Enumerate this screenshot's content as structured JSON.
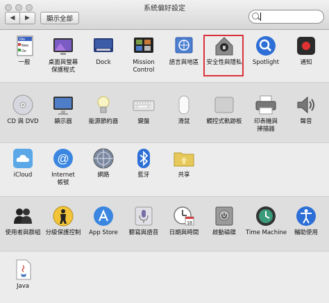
{
  "window": {
    "title": "系統偏好設定"
  },
  "toolbar": {
    "back": "◀",
    "forward": "▶",
    "show_all": "顯示全部"
  },
  "search": {
    "value": ""
  },
  "rows": [
    {
      "items": [
        {
          "label": "一般",
          "icon": "general-icon"
        },
        {
          "label": "桌面與螢幕\n保護程式",
          "icon": "desktop-icon"
        },
        {
          "label": "Dock",
          "icon": "dock-icon"
        },
        {
          "label": "Mission\nControl",
          "icon": "mission-control-icon"
        },
        {
          "label": "語言與地區",
          "icon": "language-icon"
        },
        {
          "label": "安全性與隱私",
          "icon": "security-icon"
        },
        {
          "label": "Spotlight",
          "icon": "spotlight-icon"
        },
        {
          "label": "通知",
          "icon": "notifications-icon"
        }
      ]
    },
    {
      "items": [
        {
          "label": "CD 與 DVD",
          "icon": "cd-dvd-icon"
        },
        {
          "label": "顯示器",
          "icon": "display-icon"
        },
        {
          "label": "能源節約器",
          "icon": "energy-icon"
        },
        {
          "label": "鍵盤",
          "icon": "keyboard-icon"
        },
        {
          "label": "滑鼠",
          "icon": "mouse-icon"
        },
        {
          "label": "觸控式軌跡板",
          "icon": "trackpad-icon"
        },
        {
          "label": "印表機與\n掃描器",
          "icon": "printer-icon"
        },
        {
          "label": "聲音",
          "icon": "sound-icon"
        }
      ]
    },
    {
      "items": [
        {
          "label": "iCloud",
          "icon": "icloud-icon"
        },
        {
          "label": "Internet\n帳號",
          "icon": "internet-accounts-icon"
        },
        {
          "label": "網路",
          "icon": "network-icon"
        },
        {
          "label": "藍牙",
          "icon": "bluetooth-icon"
        },
        {
          "label": "共享",
          "icon": "sharing-icon"
        }
      ]
    },
    {
      "items": [
        {
          "label": "使用者與群組",
          "icon": "users-icon"
        },
        {
          "label": "分級保護控制",
          "icon": "parental-icon"
        },
        {
          "label": "App Store",
          "icon": "appstore-icon"
        },
        {
          "label": "聽寫與語音",
          "icon": "dictation-icon"
        },
        {
          "label": "日期與時間",
          "icon": "datetime-icon"
        },
        {
          "label": "啟動磁碟",
          "icon": "startup-disk-icon"
        },
        {
          "label": "Time Machine",
          "icon": "timemachine-icon"
        },
        {
          "label": "輔助使用",
          "icon": "accessibility-icon"
        }
      ]
    },
    {
      "items": [
        {
          "label": "Java",
          "icon": "java-icon"
        }
      ]
    }
  ],
  "icon_texts": {
    "general_file": "File",
    "general_new": "New",
    "general_one": "On",
    "date_day": "18"
  },
  "colors": {
    "highlight": "#d8313a",
    "blue": "#2d6fd6"
  }
}
